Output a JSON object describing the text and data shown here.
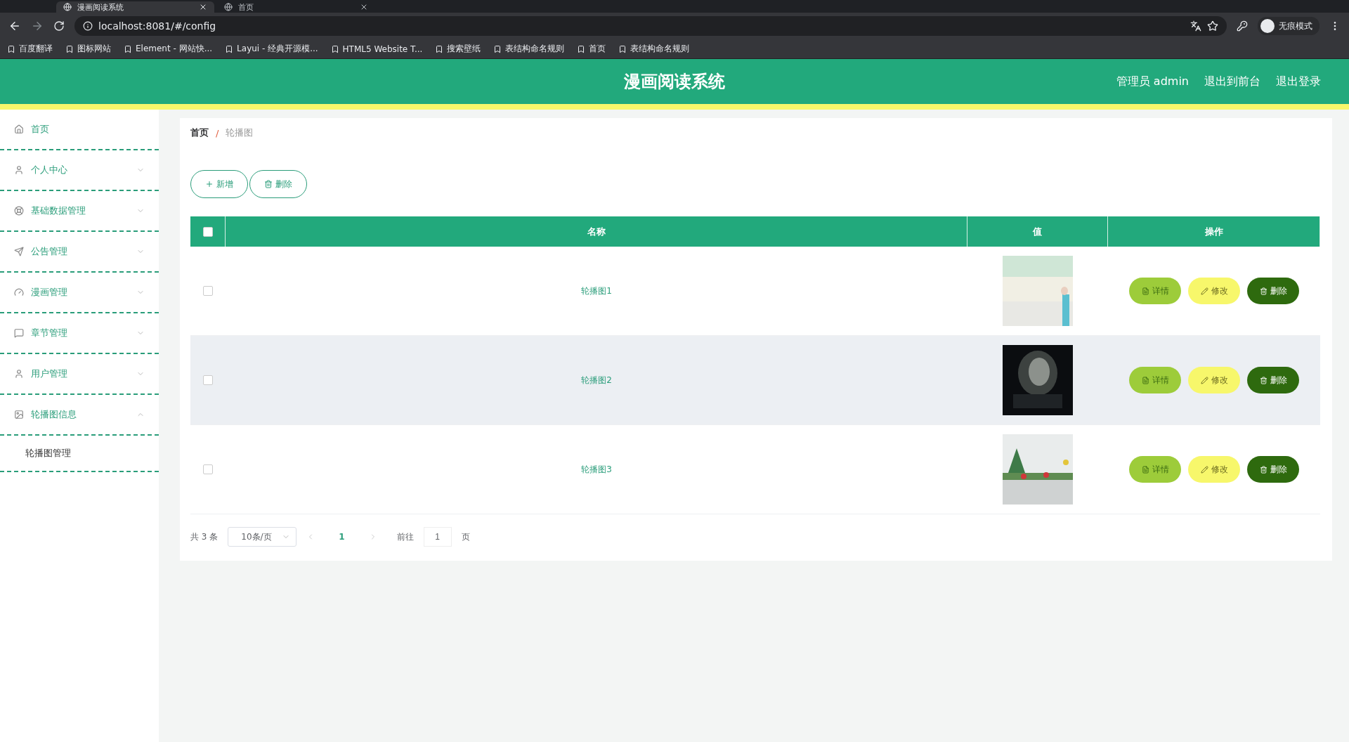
{
  "browser": {
    "tabs": [
      {
        "title": "漫画阅读系统",
        "selected": true
      },
      {
        "title": "首页",
        "selected": false
      }
    ],
    "address": "localhost:8081/#/config",
    "bookmarks": [
      "百度翻译",
      "图标网站",
      "Element - 网站快...",
      "Layui - 经典开源模...",
      "HTML5 Website T...",
      "搜索壁纸",
      "表结构命名规则",
      "首页",
      "表结构命名规则"
    ],
    "profile": "无痕模式"
  },
  "header": {
    "title": "漫画阅读系统",
    "links": [
      "管理员 admin",
      "退出到前台",
      "退出登录"
    ]
  },
  "sidebar": {
    "items": [
      {
        "label": "首页"
      },
      {
        "label": "个人中心",
        "expanded": false
      },
      {
        "label": "基础数据管理",
        "expanded": false
      },
      {
        "label": "公告管理",
        "expanded": false
      },
      {
        "label": "漫画管理",
        "expanded": false
      },
      {
        "label": "章节管理",
        "expanded": false
      },
      {
        "label": "用户管理",
        "expanded": false
      },
      {
        "label": "轮播图信息",
        "expanded": true,
        "children": [
          {
            "label": "轮播图管理"
          }
        ]
      }
    ]
  },
  "breadcrumb": {
    "items": [
      "首页",
      "轮播图"
    ],
    "separator": "/"
  },
  "toolbar": [
    {
      "label": "新增",
      "kind": "add"
    },
    {
      "label": "删除",
      "kind": "delete"
    }
  ],
  "table": {
    "header_checked": false,
    "columns": [
      "名称",
      "值",
      "操作"
    ],
    "rows": [
      {
        "checked": false,
        "name": "轮播图1",
        "highlighted": false,
        "actions": [
          {
            "label": "详情",
            "kind": "detail"
          },
          {
            "label": "修改",
            "kind": "edit"
          },
          {
            "label": "删除",
            "kind": "delete"
          }
        ]
      },
      {
        "checked": false,
        "name": "轮播图2",
        "highlighted": true,
        "actions": [
          {
            "label": "详情",
            "kind": "detail"
          },
          {
            "label": "修改",
            "kind": "edit"
          },
          {
            "label": "删除",
            "kind": "delete"
          }
        ]
      },
      {
        "checked": false,
        "name": "轮播图3",
        "highlighted": false,
        "actions": [
          {
            "label": "详情",
            "kind": "detail"
          },
          {
            "label": "修改",
            "kind": "edit"
          },
          {
            "label": "删除",
            "kind": "delete"
          }
        ]
      }
    ]
  },
  "pagination": {
    "total": "共 3 条",
    "page_size": "10条/页",
    "pages": [
      {
        "label": "1",
        "selected": true
      }
    ],
    "goto_label": "前往",
    "goto_value": "1",
    "goto_suffix": "页"
  }
}
